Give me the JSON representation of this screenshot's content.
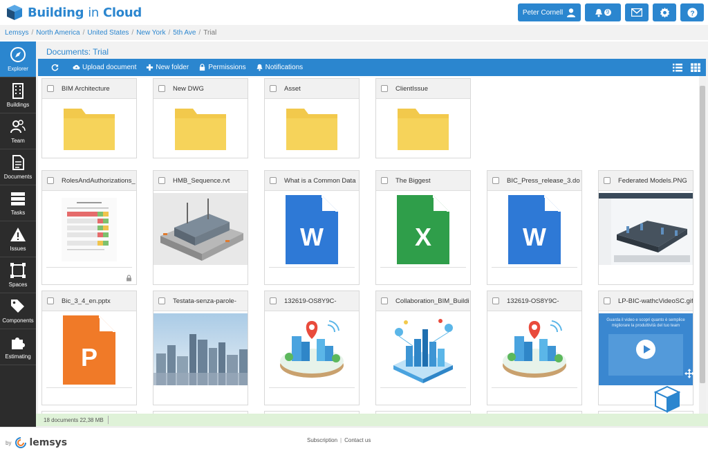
{
  "app": {
    "name_part1": "Building",
    "name_part2": "in",
    "name_part3": "Cloud"
  },
  "header": {
    "user_name": "Peter Cornell",
    "notification_count": "9"
  },
  "breadcrumb": {
    "items": [
      "Lemsys",
      "North America",
      "United States",
      "New York",
      "5th Ave"
    ],
    "current": "Trial"
  },
  "sidebar": {
    "items": [
      {
        "label": "Explorer",
        "icon": "compass-icon"
      },
      {
        "label": "Buildings",
        "icon": "building-icon"
      },
      {
        "label": "Team",
        "icon": "team-icon"
      },
      {
        "label": "Documents",
        "icon": "document-icon"
      },
      {
        "label": "Tasks",
        "icon": "tasks-icon"
      },
      {
        "label": "Issues",
        "icon": "warning-icon"
      },
      {
        "label": "Spaces",
        "icon": "spaces-icon"
      },
      {
        "label": "Components",
        "icon": "tags-icon"
      },
      {
        "label": "Estimating",
        "icon": "puzzle-icon"
      }
    ]
  },
  "main": {
    "title": "Documents: Trial"
  },
  "toolbar": {
    "upload": "Upload document",
    "new_folder": "New folder",
    "permissions": "Permissions",
    "notifications": "Notifications"
  },
  "folders": [
    {
      "name": "BIM Architecture"
    },
    {
      "name": "New DWG"
    },
    {
      "name": "Asset"
    },
    {
      "name": "ClientIssue"
    }
  ],
  "files_row1": [
    {
      "name": "RolesAndAuthorizations_",
      "kind": "document-thumbnail"
    },
    {
      "name": "HMB_Sequence.rvt",
      "kind": "bim-model-thumbnail"
    },
    {
      "name": "What is a Common Data",
      "kind": "word-icon"
    },
    {
      "name": "The Biggest",
      "kind": "excel-icon"
    },
    {
      "name": "BIC_Press_release_3.do",
      "kind": "word-icon"
    },
    {
      "name": "Federated Models.PNG",
      "kind": "screenshot-thumbnail"
    }
  ],
  "files_row2": [
    {
      "name": "Bic_3_4_en.pptx",
      "kind": "powerpoint-icon"
    },
    {
      "name": "Testata-senza-parole-",
      "kind": "city-photo"
    },
    {
      "name": "132619-OS8Y9C-",
      "kind": "smart-city-illustration"
    },
    {
      "name": "Collaboration_BIM_Buildi",
      "kind": "blue-city-illustration"
    },
    {
      "name": "132619-OS8Y9C-",
      "kind": "smart-city-illustration"
    },
    {
      "name": "LP-BIC-wathcVideoSC.gif",
      "kind": "video-thumbnail"
    }
  ],
  "file_icons": {
    "word_letter": "W",
    "excel_letter": "X",
    "powerpoint_letter": "P"
  },
  "video_caption": "Guarda il video e scopri quanto è semplice migliorare la produttività del tuo team",
  "status": {
    "text": "18 documents 22,38 MB"
  },
  "footer": {
    "by": "by",
    "brand": "lemsys",
    "subscription": "Subscription",
    "contact": "Contact us"
  },
  "colors": {
    "accent": "#2b86cf",
    "sidebar": "#2c2c2c",
    "folder": "#f2c94c",
    "word": "#2e79d6",
    "excel": "#2f9e4a",
    "powerpoint": "#f07a28"
  }
}
